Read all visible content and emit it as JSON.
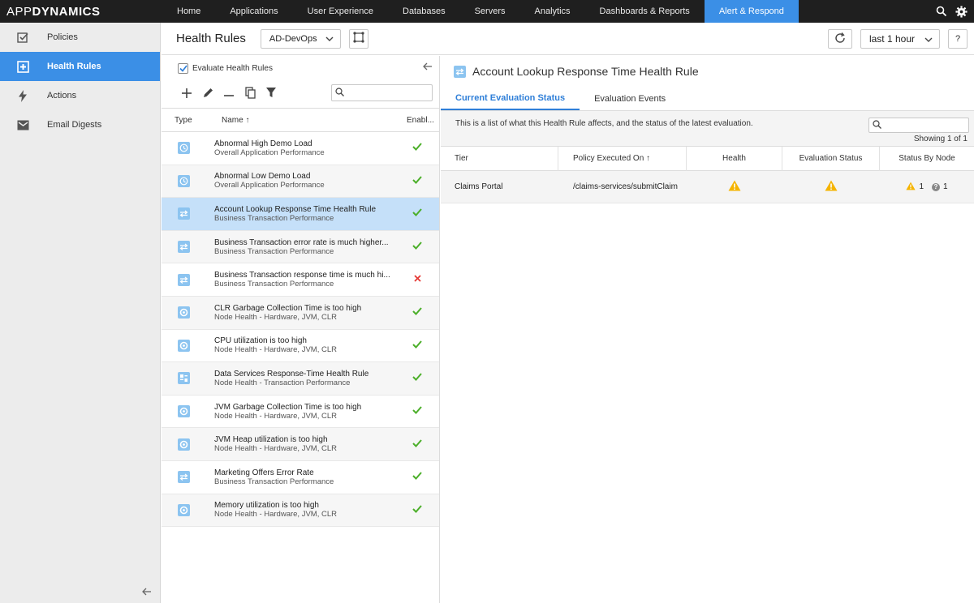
{
  "brand": {
    "part1": "APP",
    "part2": "DYNAMICS"
  },
  "nav": [
    {
      "label": "Home"
    },
    {
      "label": "Applications"
    },
    {
      "label": "User Experience"
    },
    {
      "label": "Databases"
    },
    {
      "label": "Servers"
    },
    {
      "label": "Analytics"
    },
    {
      "label": "Dashboards & Reports"
    },
    {
      "label": "Alert & Respond",
      "active": true
    }
  ],
  "sidebar": {
    "items": [
      {
        "label": "Policies",
        "icon": "checkbox-icon"
      },
      {
        "label": "Health Rules",
        "icon": "plus-box-icon",
        "active": true
      },
      {
        "label": "Actions",
        "icon": "lightning-icon"
      },
      {
        "label": "Email Digests",
        "icon": "envelope-icon"
      }
    ]
  },
  "header": {
    "title": "Health Rules",
    "app_select": "AD-DevOps",
    "time_range": "last 1 hour",
    "help": "?"
  },
  "list": {
    "evaluate_label": "Evaluate Health Rules",
    "search_placeholder": "",
    "columns": {
      "type": "Type",
      "name": "Name ↑",
      "enabled": "Enabl..."
    },
    "rules": [
      {
        "name": "Abnormal High Demo Load",
        "sub": "Overall Application Performance",
        "type": "clock",
        "enabled": true
      },
      {
        "name": "Abnormal Low Demo Load",
        "sub": "Overall Application Performance",
        "type": "clock",
        "enabled": true
      },
      {
        "name": "Account Lookup Response Time Health Rule",
        "sub": "Business Transaction Performance",
        "type": "transaction",
        "enabled": true,
        "selected": true
      },
      {
        "name": "Business Transaction error rate is much higher...",
        "sub": "Business Transaction Performance",
        "type": "transaction",
        "enabled": true
      },
      {
        "name": "Business Transaction response time is much hi...",
        "sub": "Business Transaction Performance",
        "type": "transaction",
        "enabled": false
      },
      {
        "name": "CLR Garbage Collection Time is too high",
        "sub": "Node Health - Hardware, JVM, CLR",
        "type": "node",
        "enabled": true
      },
      {
        "name": "CPU utilization is too high",
        "sub": "Node Health - Hardware, JVM, CLR",
        "type": "node",
        "enabled": true
      },
      {
        "name": "Data Services Response-Time Health Rule",
        "sub": "Node Health - Transaction Performance",
        "type": "dataservice",
        "enabled": true
      },
      {
        "name": "JVM Garbage Collection Time is too high",
        "sub": "Node Health - Hardware, JVM, CLR",
        "type": "node",
        "enabled": true
      },
      {
        "name": "JVM Heap utilization is too high",
        "sub": "Node Health - Hardware, JVM, CLR",
        "type": "node",
        "enabled": true
      },
      {
        "name": "Marketing Offers Error Rate",
        "sub": "Business Transaction Performance",
        "type": "transaction",
        "enabled": true
      },
      {
        "name": "Memory utilization is too high",
        "sub": "Node Health - Hardware, JVM, CLR",
        "type": "node",
        "enabled": true
      }
    ]
  },
  "detail": {
    "title": "Account Lookup Response Time Health Rule",
    "tabs": [
      {
        "label": "Current Evaluation Status",
        "active": true
      },
      {
        "label": "Evaluation Events"
      }
    ],
    "info": "This is a list of what this Health Rule affects, and the status of the latest evaluation.",
    "search_placeholder": "",
    "showing": "Showing 1 of 1",
    "columns": {
      "tier": "Tier",
      "policy": "Policy Executed On ↑",
      "health": "Health",
      "eval_status": "Evaluation Status",
      "by_node": "Status By Node"
    },
    "rows": [
      {
        "tier": "Claims Portal",
        "policy": "/claims-services/submitClaim",
        "health": "warning",
        "eval_status": "warning",
        "node_warning": "1",
        "node_unknown": "1"
      }
    ]
  },
  "colors": {
    "accent": "#3b8fe6",
    "warning": "#f5b400",
    "ok": "#4caf2a",
    "error": "#e53935",
    "selected_row": "#c5e0f9"
  }
}
